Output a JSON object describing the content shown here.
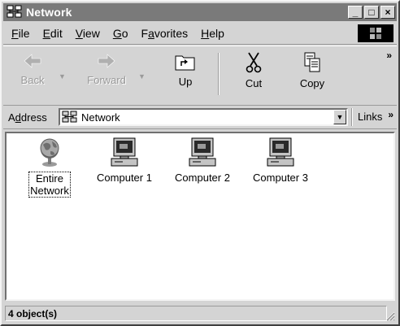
{
  "window": {
    "title": "Network",
    "controls": {
      "minimize": "_",
      "maximize": "□",
      "close": "×"
    }
  },
  "menubar": {
    "items": [
      {
        "label": "File",
        "accel": "F",
        "rest": "ile"
      },
      {
        "label": "Edit",
        "accel": "E",
        "rest": "dit"
      },
      {
        "label": "View",
        "accel": "V",
        "rest": "iew"
      },
      {
        "label": "Go",
        "accel": "G",
        "rest": "o"
      },
      {
        "label": "Favorites",
        "pre": "F",
        "accel": "a",
        "rest": "vorites"
      },
      {
        "label": "Help",
        "accel": "H",
        "rest": "elp"
      }
    ]
  },
  "toolbar": {
    "back_label": "Back",
    "forward_label": "Forward",
    "up_label": "Up",
    "cut_label": "Cut",
    "copy_label": "Copy",
    "more": "»"
  },
  "addressbar": {
    "label": "Address",
    "label_pre": "A",
    "label_accel": "d",
    "label_rest": "dress",
    "value": "Network",
    "links_label": "Links",
    "links_more": "»"
  },
  "content": {
    "items": [
      {
        "label_line1": "Entire",
        "label_line2": "Network",
        "icon": "globe-icon"
      },
      {
        "label_line1": "Computer 1",
        "icon": "computer-icon"
      },
      {
        "label_line1": "Computer 2",
        "icon": "computer-icon"
      },
      {
        "label_line1": "Computer 3",
        "icon": "computer-icon"
      }
    ]
  },
  "statusbar": {
    "text": "4 object(s)"
  },
  "colors": {
    "titlebar": "#7a7a7a",
    "face": "#d4d4d4",
    "content_bg": "#ffffff"
  }
}
